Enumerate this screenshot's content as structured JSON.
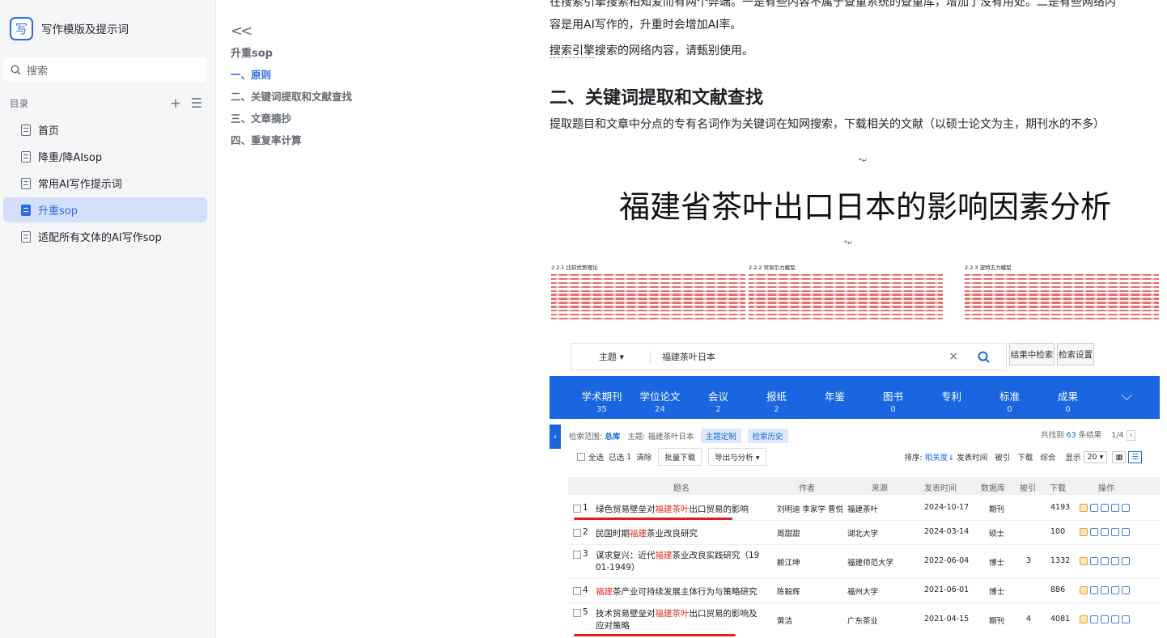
{
  "app": {
    "title": "写作模版及提示词",
    "logo_glyph": "写"
  },
  "search": {
    "placeholder": "搜索"
  },
  "toc_header": {
    "label": "目录"
  },
  "nav": {
    "items": [
      {
        "label": "首页"
      },
      {
        "label": "降重/降AIsop"
      },
      {
        "label": "常用AI写作提示词"
      },
      {
        "label": "升重sop",
        "active": true
      },
      {
        "label": "适配所有文体的AI写作sop"
      }
    ]
  },
  "outline": {
    "title": "升重sop",
    "items": [
      "一、原则",
      "二、关键词提取和文献查找",
      "三、文章摘抄",
      "四、重复率计算"
    ]
  },
  "doc": {
    "para_top_1": "在搜索引擎搜索相知爱而有两个弊端。一是有些内容不属于查重系统的查重库，增加了没有用处。二是有些网络内",
    "para_top_2": "容是用AI写作的，升重时会增加AI率。",
    "para_2_hl": "搜索引擎",
    "para_2_rest": "搜索的网络内容，请甄别使用。",
    "heading": "二、关键词提取和文献查找",
    "para_3": "提取题目和文章中分点的专有名词作为关键词在知网搜索，下载相关的文献（以硕士论文为主，期刊水的不多）"
  },
  "image1": {
    "title": "福建省茶叶出口日本的影响因素分析",
    "col_headings": [
      "2.2.1 比较优势理论",
      "2.2.2 贸易引力模型",
      "2.2.3 波特五力模型"
    ]
  },
  "cnki": {
    "search_field": "主题",
    "query": "福建茶叶日本",
    "btn_in_results": "结果中检索",
    "btn_settings": "检索设置",
    "categories": [
      {
        "name": "学术期刊",
        "count": "35"
      },
      {
        "name": "学位论文",
        "count": "24"
      },
      {
        "name": "会议",
        "count": "2"
      },
      {
        "name": "报纸",
        "count": "2"
      },
      {
        "name": "年鉴",
        "count": ""
      },
      {
        "name": "图书",
        "count": "0"
      },
      {
        "name": "专利",
        "count": ""
      },
      {
        "name": "标准",
        "count": "0"
      },
      {
        "name": "成果",
        "count": "0"
      }
    ],
    "range_label": "检索范围:",
    "range_value": "总库",
    "topic_label": "主题:",
    "topic_value": "福建茶叶日本",
    "tag1": "主题定制",
    "tag2": "检索历史",
    "result_prefix": "共找到",
    "result_count": "63",
    "result_suffix": "条结果",
    "page": "1/4",
    "select_all": "全选",
    "selected": "已选",
    "selected_count": "1",
    "clear": "清除",
    "batch_download": "批量下载",
    "export": "导出与分析",
    "sort_label": "排序:",
    "sort_relevance": "相关度",
    "sort_date": "发表时间",
    "sort_cited": "被引",
    "sort_download": "下载",
    "sort_overall": "综合",
    "show_label": "显示",
    "show_count": "20",
    "headers": [
      "题名",
      "作者",
      "来源",
      "发表时间",
      "数据库",
      "被引",
      "下载",
      "操作"
    ],
    "rows": [
      {
        "n": "1",
        "title_a": "绿色贸易壁垒对",
        "title_red": "福建茶叶",
        "title_b": "出口贸易的影响",
        "title_c": "",
        "author": "刘明迪 李家学 曹悦",
        "source": "福建茶叶",
        "date": "2024-10-17",
        "db": "期刊",
        "cited": "",
        "dl": "4193"
      },
      {
        "n": "2",
        "title_a": "民国时期",
        "title_red": "福建",
        "title_b": "茶业改良研究",
        "title_c": "",
        "author": "周甜甜",
        "source": "湖北大学",
        "date": "2024-03-14",
        "db": "硕士",
        "cited": "",
        "dl": "100"
      },
      {
        "n": "3",
        "title_a": "谋求复兴：近代",
        "title_red": "福建",
        "title_b": "茶业改良实践研究（19",
        "title_c": "01-1949）",
        "author": "赖江坤",
        "source": "福建师范大学",
        "date": "2022-06-04",
        "db": "博士",
        "cited": "3",
        "dl": "1332"
      },
      {
        "n": "4",
        "title_a": "",
        "title_red": "福建",
        "title_b": "茶产业可持续发展主体行为与策略研究",
        "title_c": "",
        "author": "陈毅辉",
        "source": "福州大学",
        "date": "2021-06-01",
        "db": "博士",
        "cited": "",
        "dl": "886"
      },
      {
        "n": "5",
        "title_a": "技术贸易壁垒对",
        "title_red": "福建茶叶",
        "title_b": "出口贸易的影响及",
        "title_c": "应对策略",
        "author": "黄洁",
        "source": "广东茶业",
        "date": "2021-04-15",
        "db": "期刊",
        "cited": "4",
        "dl": "4081"
      }
    ]
  }
}
